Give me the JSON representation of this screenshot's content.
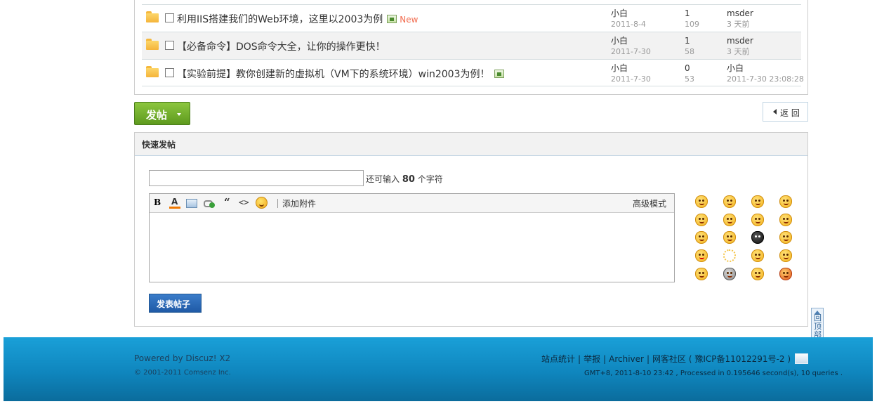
{
  "threads": [
    {
      "title": "利用IIS搭建我们的Web环境，这里以2003为例",
      "has_image": true,
      "new_label": "New",
      "author": "小白",
      "date": "2011-8-4",
      "replies": "1",
      "views": "109",
      "last_user": "msder",
      "last_time": "3 天前"
    },
    {
      "title": "【必备命令】DOS命令大全，让你的操作更快！",
      "has_image": false,
      "new_label": "",
      "author": "小白",
      "date": "2011-7-30",
      "replies": "1",
      "views": "58",
      "last_user": "msder",
      "last_time": "3 天前"
    },
    {
      "title": "【实验前提】教你创建新的虚拟机（VM下的系统环境）win2003为例！",
      "has_image": true,
      "new_label": "",
      "author": "小白",
      "date": "2011-7-30",
      "replies": "0",
      "views": "53",
      "last_user": "小白",
      "last_time": "2011-7-30 23:08:28"
    }
  ],
  "buttons": {
    "post": "发帖",
    "back": "返 回"
  },
  "quick_post": {
    "heading": "快速发帖",
    "subject_value": "",
    "remain_prefix": "还可输入",
    "remain_count": "80",
    "remain_suffix": "个字符",
    "toolbar": {
      "bold": "B",
      "color": "A",
      "quote": "“",
      "code": "<>",
      "attach": "添加附件",
      "advanced": "高级模式"
    },
    "submit": "发表帖子"
  },
  "back_to_top": "回顶部",
  "footer": {
    "powered": "Powered by Discuz! X2",
    "copyright": "© 2001-2011 Comsenz Inc.",
    "links": [
      "站点统计",
      "举报",
      "Archiver",
      "网客社区 ( 豫ICP备11012291号-2 )"
    ],
    "gmt": "GMT+8, 2011-8-10 23:42 , Processed in 0.195646 second(s), 10 queries ."
  },
  "colors": {
    "post_button": "#6aa82a",
    "submit_button": "#2a69b5",
    "footer": "#1595cf",
    "new_tag": "#f26c4f"
  }
}
